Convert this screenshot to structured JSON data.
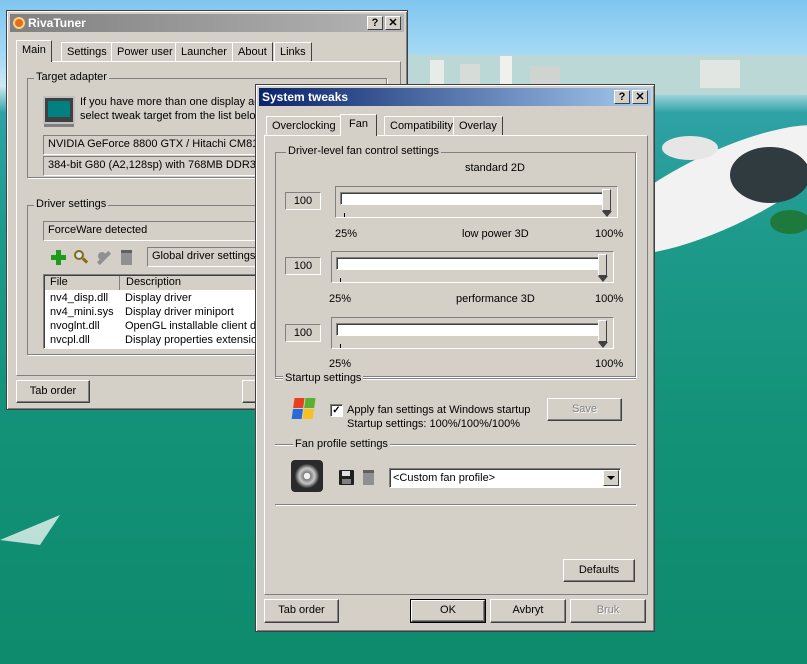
{
  "rt": {
    "title": "RivaTuner",
    "tabs": [
      "Main",
      "Settings",
      "Power user",
      "Launcher",
      "About",
      "Links"
    ],
    "target_group": "Target adapter",
    "target_text1": "If you have more than one display ada",
    "target_text2": "select tweak target from the list below",
    "adapter_select": "NVIDIA GeForce 8800 GTX / Hitachi CM811",
    "adapter_info": "384-bit G80 (A2,128sp) with 768MB DDR3",
    "driver_group": "Driver settings",
    "driver_detect": "ForceWare detected",
    "global_select": "Global driver settings",
    "cols": [
      "File",
      "Description"
    ],
    "rows": [
      {
        "file": "nv4_disp.dll",
        "desc": "Display driver"
      },
      {
        "file": "nv4_mini.sys",
        "desc": "Display driver miniport"
      },
      {
        "file": "nvoglnt.dll",
        "desc": "OpenGL installable client dr"
      },
      {
        "file": "nvcpl.dll",
        "desc": "Display properties extension"
      }
    ],
    "tab_order": "Tab order"
  },
  "st": {
    "title": "System tweaks",
    "tabs": [
      "Overclocking",
      "Fan",
      "Compatibility",
      "Overlay"
    ],
    "fan_group": "Driver-level fan control settings",
    "sliders": [
      {
        "mode": "standard 2D",
        "value": "100",
        "level": 1.0
      },
      {
        "mode": "low power 3D",
        "value": "100",
        "level": 1.0
      },
      {
        "mode": "performance 3D",
        "value": "100",
        "level": 1.0
      }
    ],
    "min_label": "25%",
    "max_label": "100%",
    "startup_group": "Startup settings",
    "apply_label": "Apply fan settings at Windows startup",
    "apply_checked": true,
    "startup_info": "Startup settings:  100%/100%/100%",
    "save": "Save",
    "profile_group": "Fan profile settings",
    "profile_select": "<Custom fan profile>",
    "defaults": "Defaults",
    "tab_order": "Tab order",
    "ok": "OK",
    "cancel": "Avbryt",
    "apply": "Bruk"
  }
}
